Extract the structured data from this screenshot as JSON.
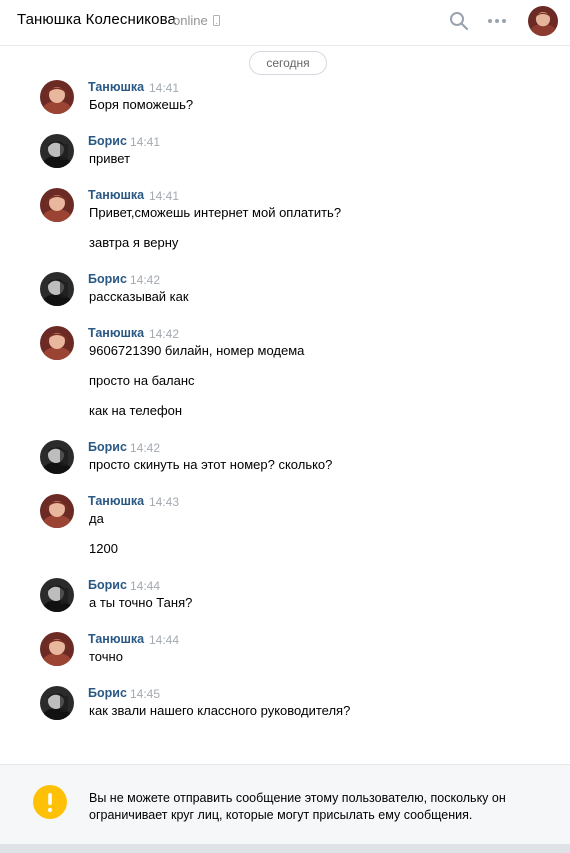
{
  "header": {
    "name": "Танюшка Колесникова",
    "status": "online",
    "icons": [
      "phone-icon",
      "search-icon",
      "more-icon"
    ]
  },
  "date_separator": "сегодня",
  "messages": [
    {
      "author": "Танюшка",
      "time": "14:41",
      "avatar": "tanya",
      "lines": [
        "Боря поможешь?"
      ]
    },
    {
      "author": "Борис",
      "time": "14:41",
      "avatar": "boris",
      "lines": [
        "привет"
      ]
    },
    {
      "author": "Танюшка",
      "time": "14:41",
      "avatar": "tanya",
      "lines": [
        "Привет,сможешь интернет мой оплатить?",
        "завтра я верну"
      ]
    },
    {
      "author": "Борис",
      "time": "14:42",
      "avatar": "boris",
      "lines": [
        "рассказывай как"
      ]
    },
    {
      "author": "Танюшка",
      "time": "14:42",
      "avatar": "tanya",
      "lines": [
        "9606721390 билайн, номер модема",
        "просто на баланс",
        "как на телефон"
      ]
    },
    {
      "author": "Борис",
      "time": "14:42",
      "avatar": "boris",
      "lines": [
        "просто скинуть на этот номер? сколько?"
      ]
    },
    {
      "author": "Танюшка",
      "time": "14:43",
      "avatar": "tanya",
      "lines": [
        "да",
        "1200"
      ]
    },
    {
      "author": "Борис",
      "time": "14:44",
      "avatar": "boris",
      "lines": [
        "а ты точно Таня?"
      ]
    },
    {
      "author": "Танюшка",
      "time": "14:44",
      "avatar": "tanya",
      "lines": [
        "точно"
      ]
    },
    {
      "author": "Борис",
      "time": "14:45",
      "avatar": "boris",
      "lines": [
        "как звали нашего классного руководителя?"
      ]
    }
  ],
  "notice": {
    "icon": "warning-icon",
    "text": "Вы не можете отправить сообщение этому пользователю, поскольку он ограничивает круг лиц, которые могут присылать ему сообщения."
  },
  "colors": {
    "author": "#2a5885",
    "time": "#a3a9b0",
    "warning": "#ffc107"
  }
}
